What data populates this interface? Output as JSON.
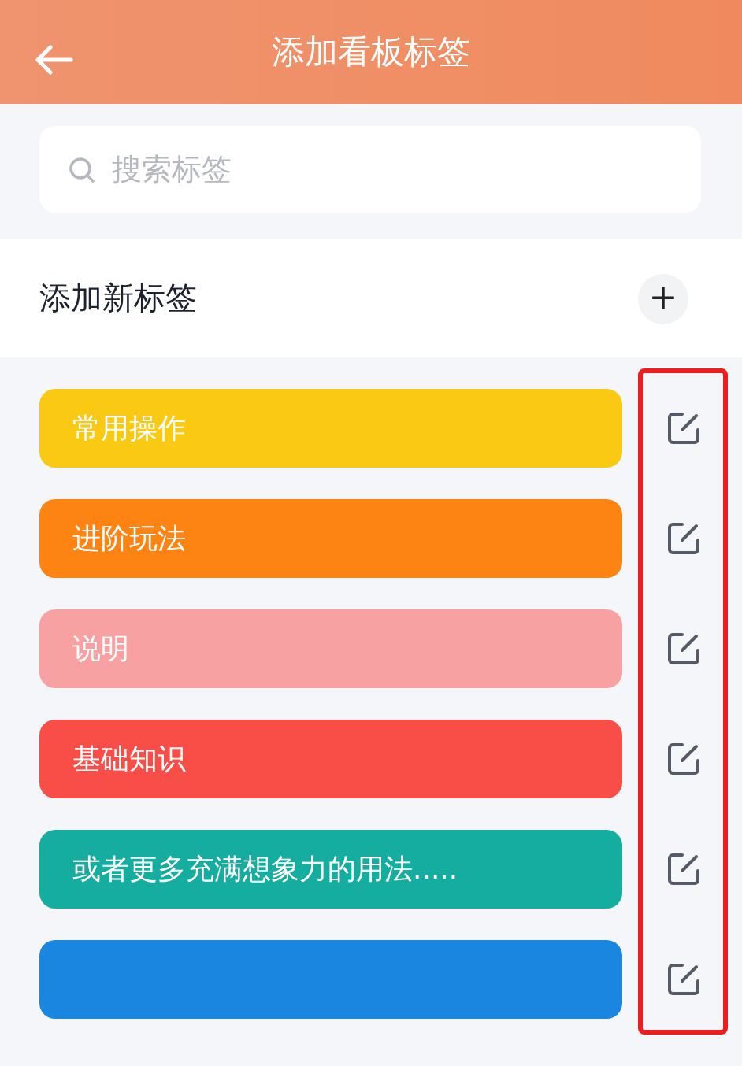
{
  "header": {
    "title": "添加看板标签"
  },
  "search": {
    "placeholder": "搜索标签"
  },
  "add_row": {
    "label": "添加新标签",
    "button": "+"
  },
  "tags": [
    {
      "name": "常用操作",
      "color": "#f9c913"
    },
    {
      "name": "进阶玩法",
      "color": "#fd8412"
    },
    {
      "name": "说明",
      "color": "#f7a1a3"
    },
    {
      "name": "基础知识",
      "color": "#f94d48"
    },
    {
      "name": "或者更多充满想象力的用法.....",
      "color": "#15ad9f"
    },
    {
      "color": "#1a86e0"
    }
  ]
}
